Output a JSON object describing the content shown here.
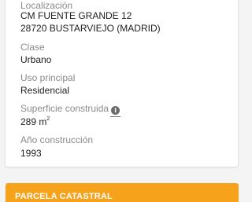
{
  "details": {
    "localizacion": {
      "label": "Localización",
      "line1": "CM FUENTE GRANDE 12",
      "line2": "28720 BUSTARVIEJO (MADRID)"
    },
    "clase": {
      "label": "Clase",
      "value": "Urbano"
    },
    "uso_principal": {
      "label": "Uso principal",
      "value": "Residencial"
    },
    "superficie_construida": {
      "label": "Superficie construida",
      "info_icon": "info-circle-icon",
      "value": "289 m",
      "unit_sup": "2"
    },
    "anio_construccion": {
      "label": "Año construcción",
      "value": "1993"
    }
  },
  "section_bar": {
    "label": "PARCELA CATASTRAL",
    "color": "#f7a21b"
  }
}
